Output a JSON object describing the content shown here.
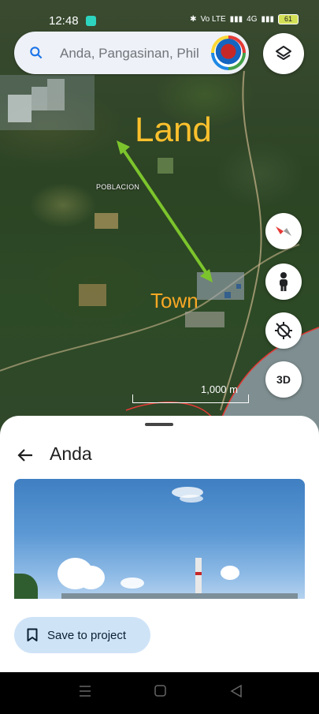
{
  "status_bar": {
    "time": "12:48",
    "battery": "61",
    "network": "4G",
    "volte": "Vo LTE"
  },
  "search": {
    "placeholder": "Anda, Pangasinan, Phil"
  },
  "map": {
    "label_land": "Land",
    "label_town": "Town",
    "place_label": "POBLACION",
    "scale_label": "1,000 m",
    "button_3d": "3D",
    "arrow_color": "#7cc42c",
    "label_color": "#fbc02d"
  },
  "place": {
    "title": "Anda"
  },
  "actions": {
    "save_label": "Save to project"
  },
  "icons": [
    "search-icon",
    "layers-icon",
    "compass-icon",
    "pegman-icon",
    "location-off-icon",
    "back-arrow-icon",
    "bookmark-icon"
  ]
}
